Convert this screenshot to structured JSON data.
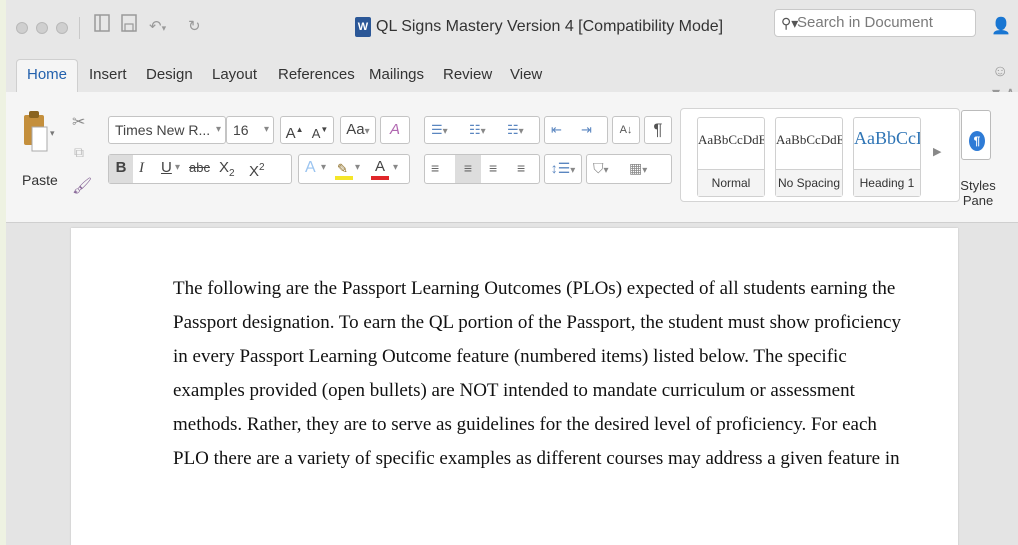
{
  "window": {
    "title": "QL Signs Mastery Version 4 [Compatibility Mode]",
    "doc_icon_letter": "W"
  },
  "search": {
    "icon": "search-icon",
    "placeholder": "Search in Document"
  },
  "tabs": [
    {
      "label": "Home",
      "active": true
    },
    {
      "label": "Insert"
    },
    {
      "label": "Design"
    },
    {
      "label": "Layout"
    },
    {
      "label": "References"
    },
    {
      "label": "Mailings"
    },
    {
      "label": "Review"
    },
    {
      "label": "View"
    }
  ],
  "ribbon": {
    "paste_label": "Paste",
    "font_name": "Times New R...",
    "font_size": "16",
    "bold": "B",
    "italic": "I",
    "underline": "U",
    "strikethrough": "abc",
    "subscript": "X",
    "subscript_mark": "2",
    "superscript": "X",
    "superscript_mark": "2",
    "grow_font": "A",
    "shrink_font": "A",
    "change_case": "Aa",
    "text_effects": "A",
    "highlight_color": "#f5e629",
    "font_color": "#e0262a",
    "font_color_letter": "A",
    "show_marks": "¶",
    "styles": [
      {
        "sample": "AaBbCcDdEe",
        "name": "Normal"
      },
      {
        "sample": "AaBbCcDdEe",
        "name": "No Spacing"
      },
      {
        "sample": "AaBbCcD",
        "name": "Heading 1",
        "color": "#2e74b5"
      }
    ],
    "styles_pane_label": "Styles Pane"
  },
  "document": {
    "lines": [
      "The following are the Passport Learning Outcomes (PLOs) expected of all students earning the",
      "Passport designation.  To earn the QL portion of the Passport, the student must show proficiency",
      "in every Passport Learning Outcome feature (numbered items) listed below.  The specific",
      "examples provided (open bullets) are NOT intended to mandate curriculum or assessment",
      "methods.  Rather, they are to serve as guidelines for the desired level of proficiency.  For each",
      "PLO there are a variety of specific examples as different courses may address a given feature in"
    ]
  }
}
